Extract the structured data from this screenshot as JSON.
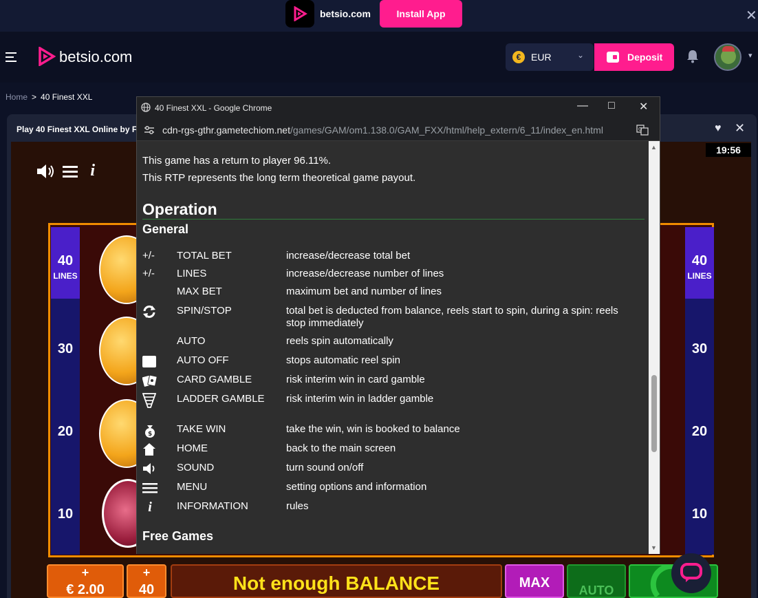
{
  "promo": {
    "brand": "betsio.com",
    "install_label": "Install App",
    "close": "✕"
  },
  "header": {
    "brand": "betsio.com",
    "currency": {
      "symbol": "€",
      "label": "EUR",
      "chevron": "⌄"
    },
    "deposit_label": "Deposit"
  },
  "breadcrumb": {
    "home": "Home",
    "separator": ">",
    "current": "40 Finest XXL"
  },
  "game_card": {
    "title": "Play 40 Finest XXL Online by F",
    "heart": "♥",
    "close": "✕"
  },
  "game": {
    "clock": "19:56",
    "info_icon": "i",
    "line_top_value": "40",
    "line_top_label": "LINES",
    "line_labels": [
      "30",
      "20",
      "10"
    ],
    "bet_plus": "+",
    "bet_value": "€ 2.00",
    "lines_plus": "+",
    "lines_value": "40",
    "balance_message": "Not enough BALANCE",
    "max_label": "MAX",
    "auto_label": "AUTO"
  },
  "popup": {
    "window_title": "40 Finest XXL - Google Chrome",
    "minimize": "—",
    "maximize": "□",
    "close": "✕",
    "url_domain": "cdn-rgs-gthr.gametechiom.net",
    "url_path": "/games/GAM/om1.138.0/GAM_FXX/html/help_extern/6_11/index_en.html",
    "rtp_line1": "This game has a return to player 96.11%.",
    "rtp_line2": "This RTP represents the long term theoretical game payout.",
    "heading_operation": "Operation",
    "heading_general": "General",
    "heading_free_games": "Free Games",
    "rows": [
      {
        "key": "+/-",
        "icon": "",
        "name": "TOTAL BET",
        "desc": "increase/decrease total bet"
      },
      {
        "key": "+/-",
        "icon": "",
        "name": "LINES",
        "desc": "increase/decrease number of lines"
      },
      {
        "key": "",
        "icon": "",
        "name": "MAX BET",
        "desc": "maximum bet and number of lines"
      },
      {
        "key": "",
        "icon": "spin-icon",
        "name": "SPIN/STOP",
        "desc": "total bet is deducted from balance, reels start to spin, during a spin: reels stop immediately"
      },
      {
        "key": "",
        "icon": "",
        "name": "AUTO",
        "desc": "reels spin automatically"
      },
      {
        "key": "",
        "icon": "stop-square-icon",
        "name": "AUTO OFF",
        "desc": "stops automatic reel spin"
      },
      {
        "key": "",
        "icon": "cards-icon",
        "name": "CARD GAMBLE",
        "desc": "risk interim win in card gamble"
      },
      {
        "key": "",
        "icon": "ladder-icon",
        "name": "LADDER GAMBLE",
        "desc": "risk interim win in ladder gamble"
      },
      {
        "key": "",
        "icon": "money-bag-icon",
        "name": "TAKE WIN",
        "desc": "take the win, win is booked to balance"
      },
      {
        "key": "",
        "icon": "home-icon",
        "name": "HOME",
        "desc": "back to the main screen"
      },
      {
        "key": "",
        "icon": "speaker-icon",
        "name": "SOUND",
        "desc": "turn sound on/off"
      },
      {
        "key": "",
        "icon": "menu-icon",
        "name": "MENU",
        "desc": "setting options and information"
      },
      {
        "key": "",
        "icon": "info-icon",
        "name": "INFORMATION",
        "desc": "rules"
      }
    ]
  },
  "colors": {
    "accent": "#ff1d8e",
    "coin": "#f3b71f",
    "balance_text": "#ffe21a",
    "rule": "#2f7d3b"
  }
}
